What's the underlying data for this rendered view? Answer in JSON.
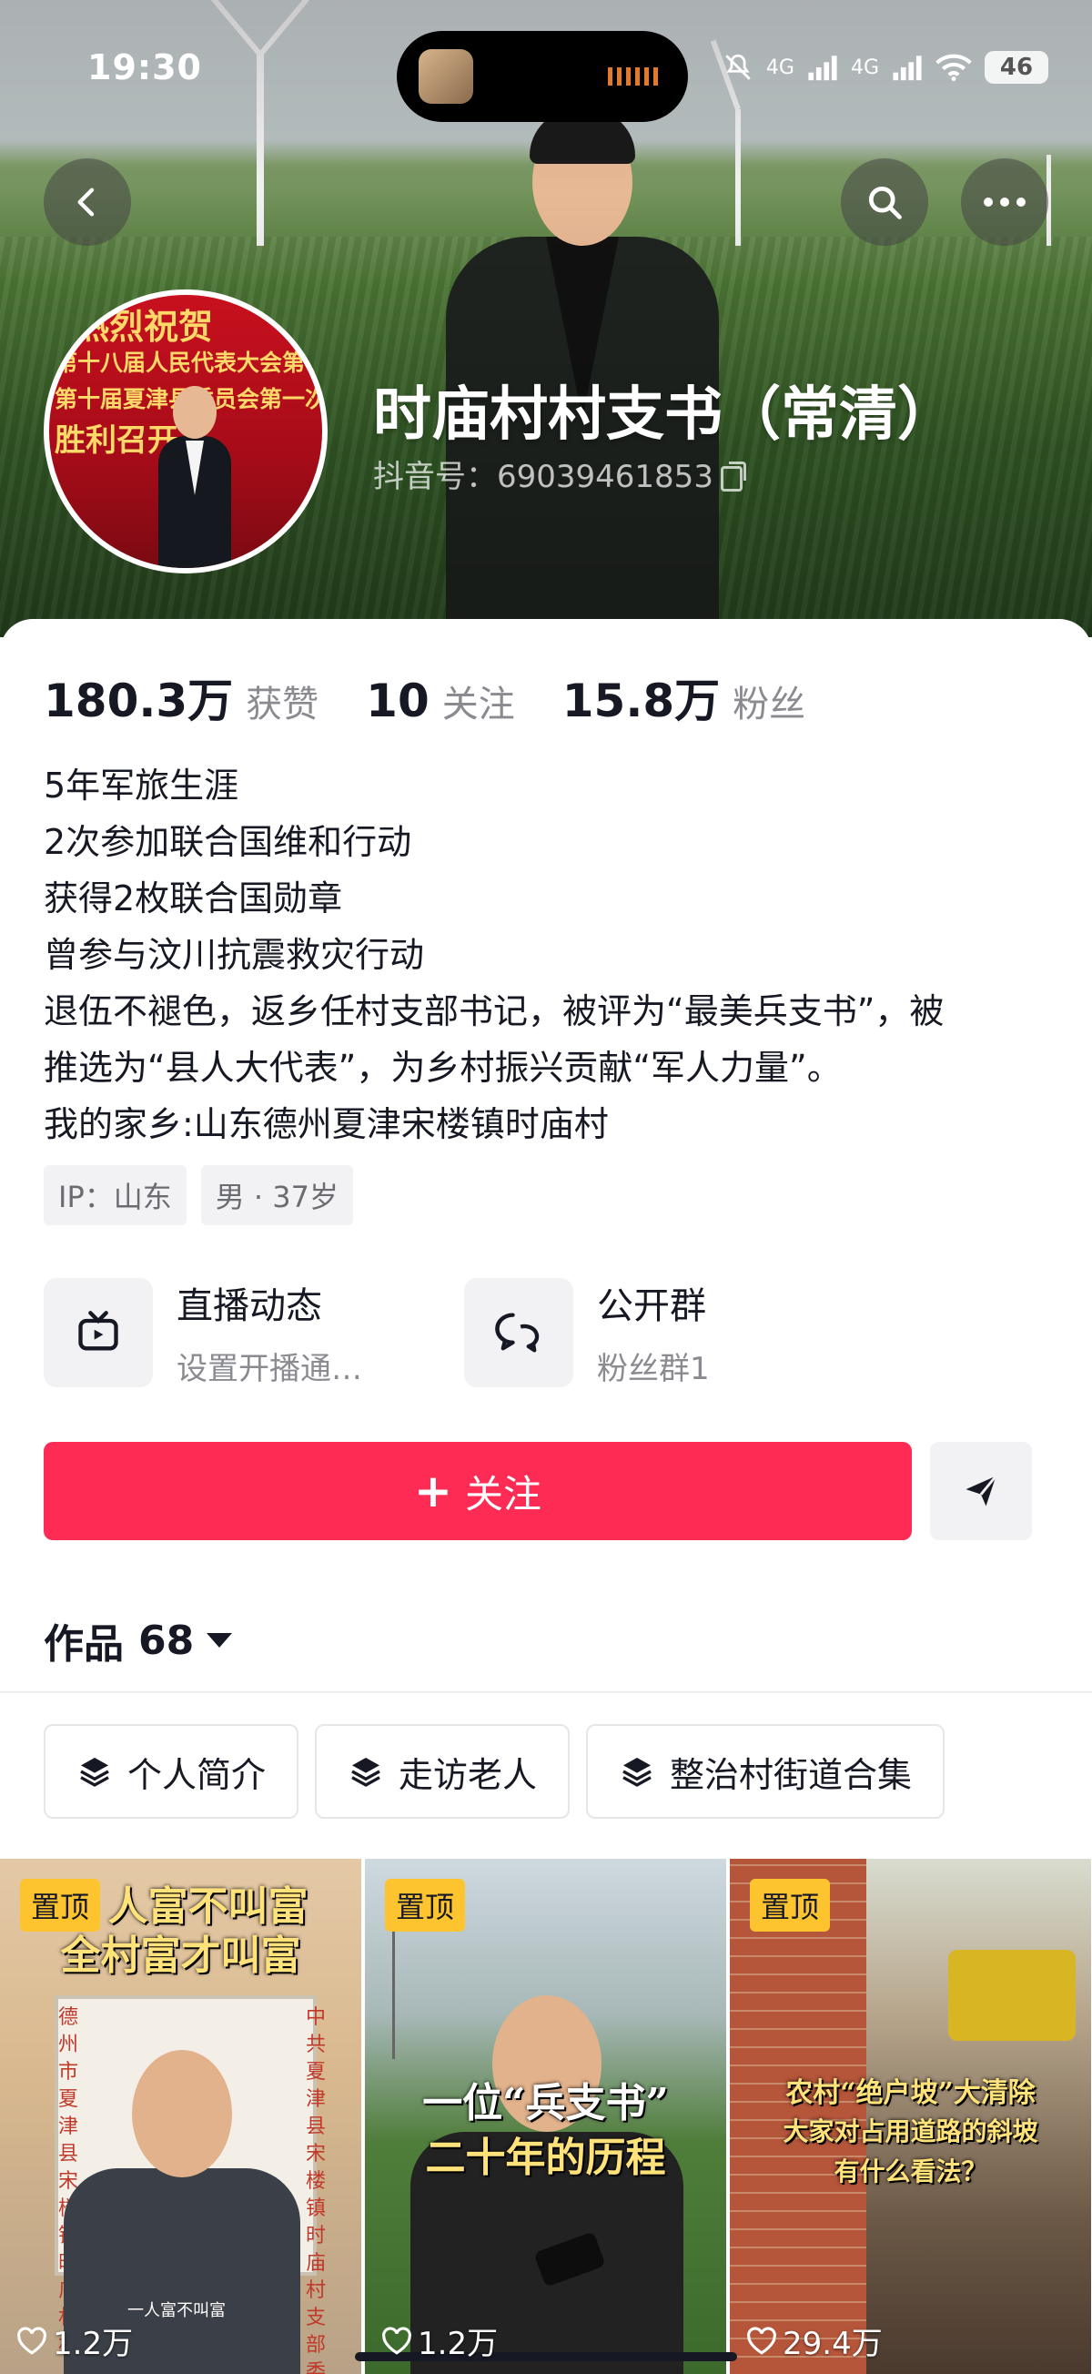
{
  "status_bar": {
    "time": "19:30",
    "network_1": "4G",
    "network_2": "4G",
    "battery": "46"
  },
  "profile": {
    "name": "时庙村村支书（常清）",
    "douyin_id": "抖音号：69039461853",
    "avatar_banner_lines": [
      "热烈祝贺",
      "第十八届人民代表大会第一次会议",
      "第十届夏津县委员会第一次会议",
      "胜利召开"
    ]
  },
  "stats": [
    {
      "value": "180.3万",
      "label": "获赞"
    },
    {
      "value": "10",
      "label": "关注"
    },
    {
      "value": "15.8万",
      "label": "粉丝"
    }
  ],
  "bio": [
    "5年军旅生涯",
    "2次参加联合国维和行动",
    "获得2枚联合国勋章",
    "曾参与汶川抗震救灾行动",
    "退伍不褪色，返乡任村支部书记，被评为“最美兵支书”，被",
    "推选为“县人大代表”，为乡村振兴贡献“军人力量”。",
    "我的家乡:山东德州夏津宋楼镇时庙村"
  ],
  "tags": [
    "IP：山东",
    "男 · 37岁"
  ],
  "features": {
    "live": {
      "title": "直播动态",
      "subtitle": "设置开播通…"
    },
    "group": {
      "title": "公开群",
      "subtitle": "粉丝群1"
    }
  },
  "actions": {
    "follow": "关注"
  },
  "works": {
    "label": "作品",
    "count": "68"
  },
  "collections": [
    "个人简介",
    "走访老人",
    "整治村街道合集"
  ],
  "videos": [
    {
      "pinned": "置顶",
      "likes": "1.2万",
      "overlay": [
        "人富不叫富",
        "全村富才叫富"
      ],
      "caption": "一人富不叫富",
      "signs": [
        "德州市夏津县宋楼镇时庙村村",
        "中共夏津县宋楼镇时庙村支部委员会"
      ]
    },
    {
      "pinned": "置顶",
      "likes": "1.2万",
      "overlay": [
        "一位“兵支书”",
        "二十年的历程"
      ]
    },
    {
      "pinned": "置顶",
      "likes": "29.4万",
      "overlay": [
        "农村“绝户坡”大清除",
        "大家对占用道路的斜坡",
        "有什么看法？"
      ]
    }
  ],
  "colors": {
    "accent": "#fe2c55",
    "pin": "#fec430"
  }
}
